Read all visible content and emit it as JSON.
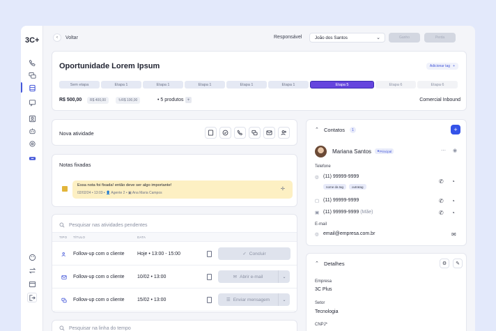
{
  "brand": {
    "logo": "3C+"
  },
  "sidebar": {
    "icons": [
      "phone-icon",
      "chats-icon",
      "crm-icon",
      "message-icon",
      "contacts-icon",
      "robot-icon",
      "integrations-icon",
      "plus-card-icon",
      "palette-icon",
      "transfer-icon",
      "calendar-icon",
      "logout-icon"
    ]
  },
  "topbar": {
    "back_label": "Voltar",
    "responsible_label": "Responsável",
    "responsible_value": "João dos Santos",
    "won_label": "Ganho",
    "lost_label": "Perda"
  },
  "opportunity": {
    "title": "Oportunidade Lorem Ipsum",
    "add_tag_label": "Adicionar tag",
    "stages": [
      {
        "label": "Sem etapa",
        "state": "done"
      },
      {
        "label": "Etapa 1",
        "state": "done"
      },
      {
        "label": "Etapa 1",
        "state": "done"
      },
      {
        "label": "Etapa 1",
        "state": "done"
      },
      {
        "label": "Etapa 1",
        "state": "done"
      },
      {
        "label": "Etapa 1",
        "state": "done"
      },
      {
        "label": "Etapa 5",
        "state": "active"
      },
      {
        "label": "Etapa 6",
        "state": "future"
      },
      {
        "label": "Etapa 6",
        "state": "future"
      }
    ],
    "price": "R$ 500,00",
    "chip1": "R$ 400,00",
    "chip2": "R$ 100,00",
    "products": "5 produtos",
    "origin": "Comercial Inbound"
  },
  "new_activity": {
    "title": "Nova atividade"
  },
  "pinned": {
    "title": "Notas fixadas",
    "note_text": "Essa nota foi fixada! então deve ser algo importante!",
    "note_date": "02/02/24",
    "note_time": "13:03",
    "note_agent": "Agente 2",
    "note_contact": "Ana Maria Campos"
  },
  "pending": {
    "search_placeholder": "Pesquisar nas atividades pendentes",
    "col_type": "TIPO",
    "col_title": "TÍTULO",
    "col_date": "DATA",
    "rows": [
      {
        "title": "Follow-up com o cliente",
        "date": "Hoje",
        "time": "13:00 - 15:00",
        "action": "Concluir",
        "icon": "contact-icon"
      },
      {
        "title": "Follow-up com o cliente",
        "date": "10/02",
        "time": "13:00",
        "action": "Abrir e-mail",
        "icon": "mail-icon"
      },
      {
        "title": "Follow-up com o cliente",
        "date": "15/02",
        "time": "13:00",
        "action": "Enviar mensagem",
        "icon": "chat-icon"
      }
    ]
  },
  "timeline": {
    "search_placeholder": "Pesquisar na linha do tempo"
  },
  "contacts": {
    "title": "Contatos",
    "count": "1",
    "name": "Mariana Santos",
    "badge": "Principal",
    "phone_label": "Telefone",
    "phones": [
      {
        "number": "(11) 99999-9999",
        "suffix": ""
      },
      {
        "number": "(11) 99999-9999",
        "suffix": ""
      },
      {
        "number": "(11) 99999-9999",
        "suffix": "(Mãe)"
      }
    ],
    "tags": [
      "nome da tag",
      "outratag"
    ],
    "email_label": "E-mail",
    "email": "email@empresa.com.br"
  },
  "details": {
    "title": "Detalhes",
    "company_label": "Empresa",
    "company": "3C Plus",
    "sector_label": "Setor",
    "sector": "Tecnologia",
    "cnpj_label": "CNPJ*"
  },
  "colors": {
    "accent": "#3453e8",
    "stage_active": "#6545de",
    "note_bg": "#fdf0c3"
  }
}
